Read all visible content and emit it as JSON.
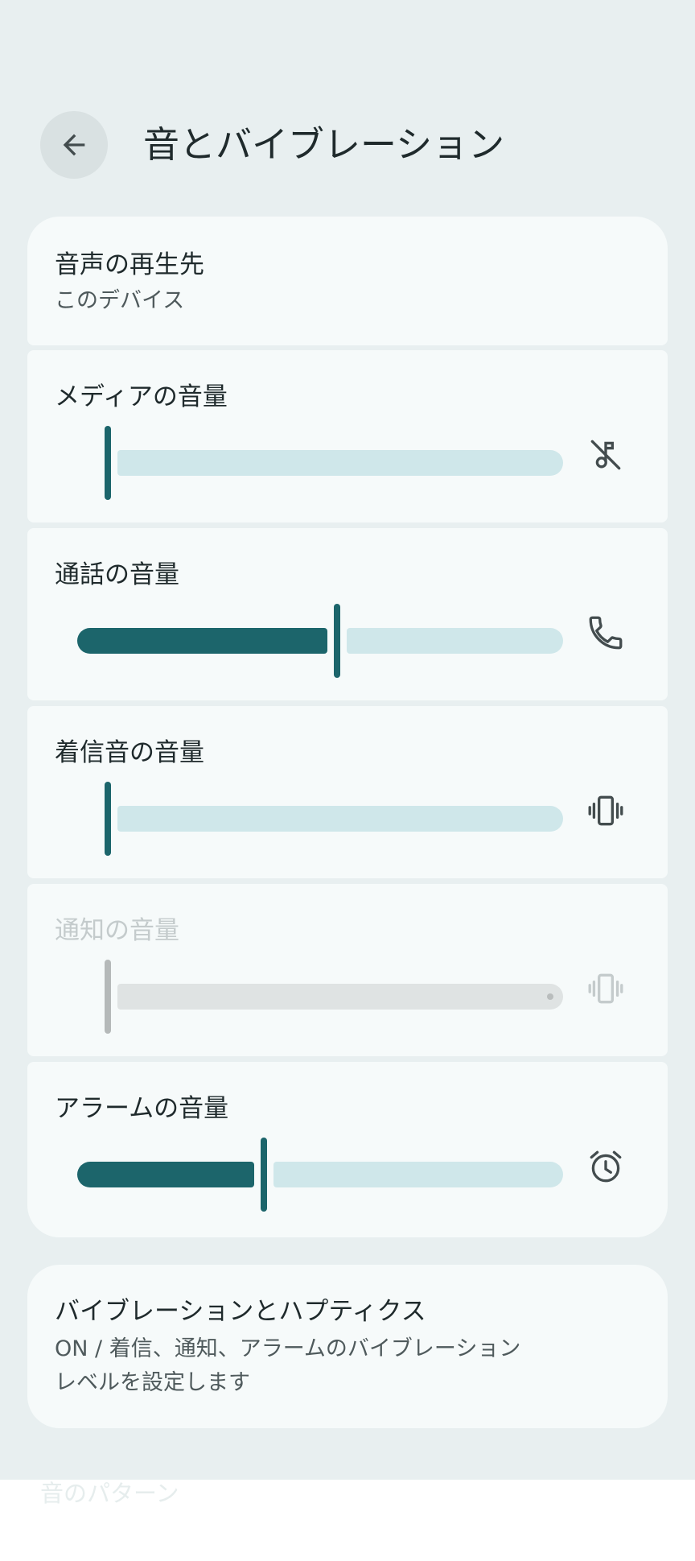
{
  "header": {
    "title": "音とバイブレーション",
    "back_icon": "arrow-back-icon"
  },
  "output": {
    "title": "音声の再生先",
    "subtitle": "このデバイス"
  },
  "volumes": [
    {
      "label": "メディアの音量",
      "level": 0.0,
      "icon": "music-off-icon",
      "enabled": true
    },
    {
      "label": "通話の音量",
      "level": 0.5,
      "icon": "phone-icon",
      "enabled": true
    },
    {
      "label": "着信音の音量",
      "level": 0.0,
      "icon": "vibrate-icon",
      "enabled": true
    },
    {
      "label": "通知の音量",
      "level": 0.0,
      "icon": "vibrate-icon",
      "enabled": false
    },
    {
      "label": "アラームの音量",
      "level": 0.34,
      "icon": "alarm-icon",
      "enabled": true
    }
  ],
  "vibration": {
    "title": "バイブレーションとハプティクス",
    "subtitle_line1": "ON / 着信、通知、アラームのバイブレーション",
    "subtitle_line2": "レベルを設定します"
  },
  "footer": {
    "hint": "音のパターン"
  },
  "colors": {
    "accent": "#1c656b",
    "track_inactive": "#cfe7ea",
    "background": "#e8eff0",
    "card": "#f6fafa"
  }
}
